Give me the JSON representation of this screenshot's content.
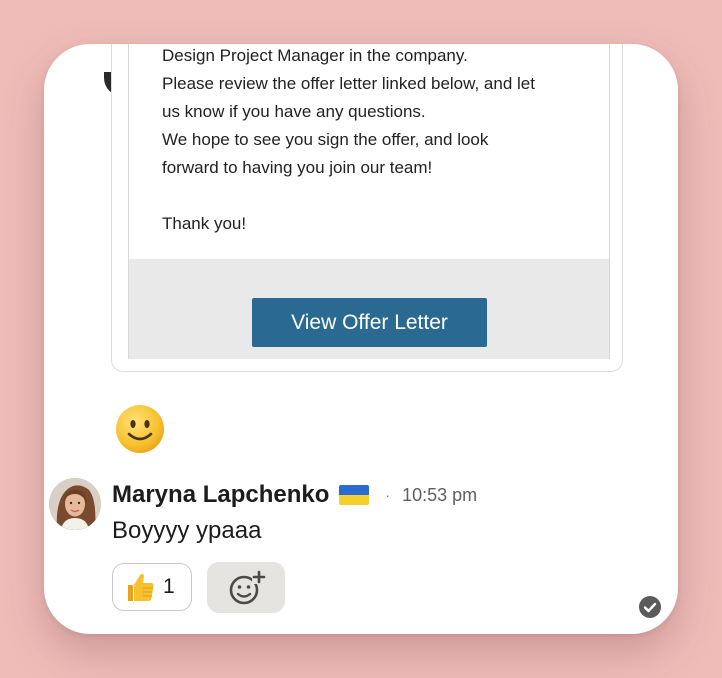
{
  "email": {
    "lines": [
      "Design Project Manager in the company.",
      "Please review the offer letter linked below, and let",
      "us know if you have any questions.",
      "We hope to see you sign the offer, and look",
      "forward to having you join our team!",
      "Thank you!"
    ],
    "button_label": "View Offer Letter",
    "button_color": "#2a6a92"
  },
  "reaction_emoji_icon": "slightly-smiling-face-icon",
  "message": {
    "author": "Maryna Lapchenko",
    "flag_icon": "ukraine-flag-icon",
    "separator": "·",
    "time": "10:53 pm",
    "text": "Boyyyy ypaaa"
  },
  "reactions": [
    {
      "icon": "thumbs-up-icon",
      "count": "1"
    }
  ],
  "add_reaction_icon": "add-reaction-icon",
  "status_icon": "check-circle-icon",
  "colors": {
    "background": "#efbcb8",
    "card": "#ffffff",
    "email_footer": "#e9e9e9",
    "add_reaction_bg": "#e6e4e1"
  }
}
